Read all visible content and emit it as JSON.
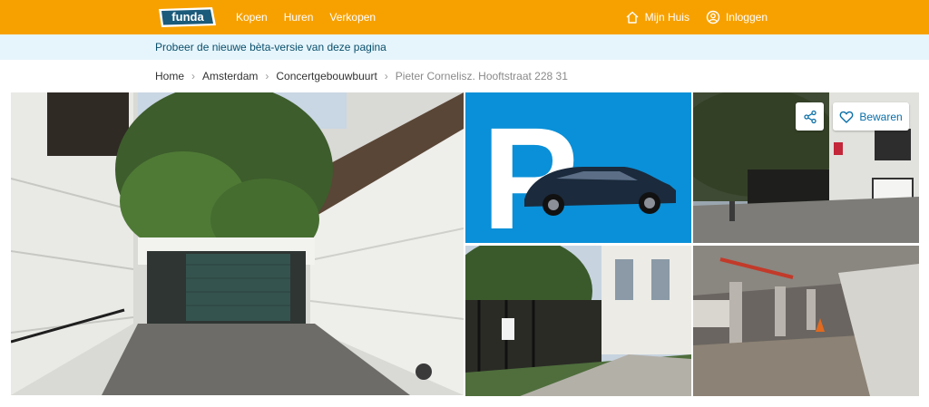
{
  "brand": {
    "logo_text": "funda",
    "color": "#f7a100"
  },
  "nav": {
    "items": [
      "Kopen",
      "Huren",
      "Verkopen"
    ]
  },
  "user": {
    "my_house": "Mijn Huis",
    "login": "Inloggen"
  },
  "beta_banner": {
    "text": "Probeer de nieuwe bèta-versie van deze pagina"
  },
  "breadcrumb": {
    "items": [
      "Home",
      "Amsterdam",
      "Concertgebouwbuurt"
    ],
    "current": "Pieter Cornelisz. Hooftstraat 228 31"
  },
  "gallery": {
    "save_label": "Bewaren",
    "parking_letter": "P"
  }
}
